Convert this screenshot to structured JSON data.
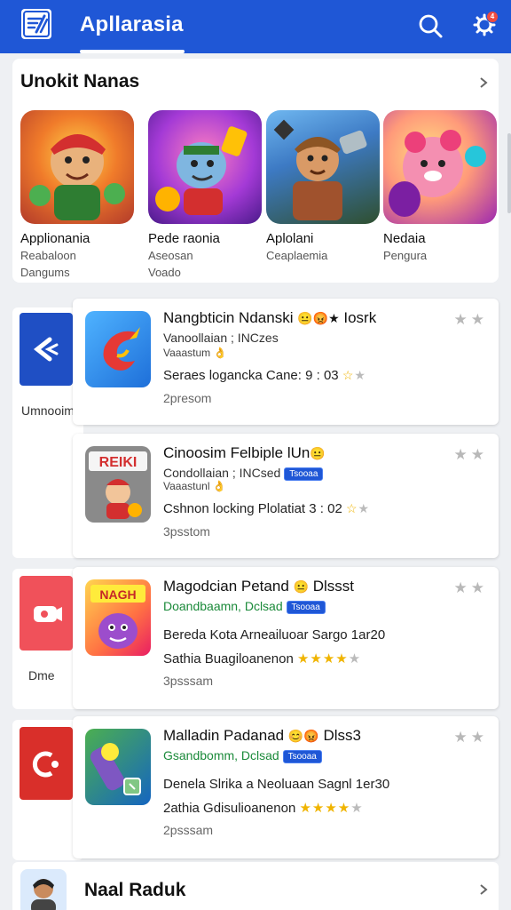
{
  "header": {
    "title": "Apllarasia",
    "logo_icon": "app-logo-icon",
    "search_icon": "search-icon",
    "settings_icon": "gear-icon",
    "notification_count": "4",
    "bar_color": "#1f57d6"
  },
  "featured": {
    "title": "Unokit Nanas",
    "items": [
      {
        "name": "Applionania",
        "sub1": "Reabaloon",
        "sub2": "Dangums"
      },
      {
        "name": "Pede raonia",
        "sub1": "Aseosan",
        "sub2": "Voado"
      },
      {
        "name": "Aplolani",
        "sub1": "Ceaplaemia",
        "sub2": ""
      },
      {
        "name": "Nedaia",
        "sub1": "Pengura",
        "sub2": ""
      }
    ]
  },
  "side_panels": [
    {
      "label": "Umnooim"
    },
    {
      "label": "Dme"
    },
    {
      "label": ""
    }
  ],
  "apps": [
    {
      "name": "Nangbticin Ndanski",
      "suffix": "Iosrk",
      "developer": "Vanoollaian ; INCzes",
      "tag": "Vaaastum",
      "line1": "Seraes logancka Cane: 9 : 03",
      "line2": "",
      "meta": "2presom",
      "badge": ""
    },
    {
      "name": "Cinoosim Felbiple",
      "suffix": "lUn",
      "developer": "Condollaian ; INCsed",
      "tag": "Vaaastunl",
      "line1": "Cshnon locking Plolatiat 3 : 02",
      "line2": "",
      "meta": "3psstom",
      "badge": "Tsooaa"
    },
    {
      "name": "Magodcian Petand",
      "suffix": "Dlssst",
      "developer": "Doandbaamn, Dclsad",
      "tag": "",
      "line1": "Bereda Kota Arneailuoar Sargo 1ar20",
      "line2": "Sathia Buagiloanenon",
      "meta": "3psssam",
      "badge": "Tsooaa"
    },
    {
      "name": "Malladin Padanad",
      "suffix": "Dlss3",
      "developer": "Gsandbomm, Dclsad",
      "tag": "",
      "line1": "Denela Slrika a Neoluaan Sagnl 1er30",
      "line2": "2athia Gdisulioanenon",
      "meta": "2psssam",
      "badge": "Tsooaa"
    }
  ],
  "bottom": {
    "title": "Naal Raduk"
  }
}
